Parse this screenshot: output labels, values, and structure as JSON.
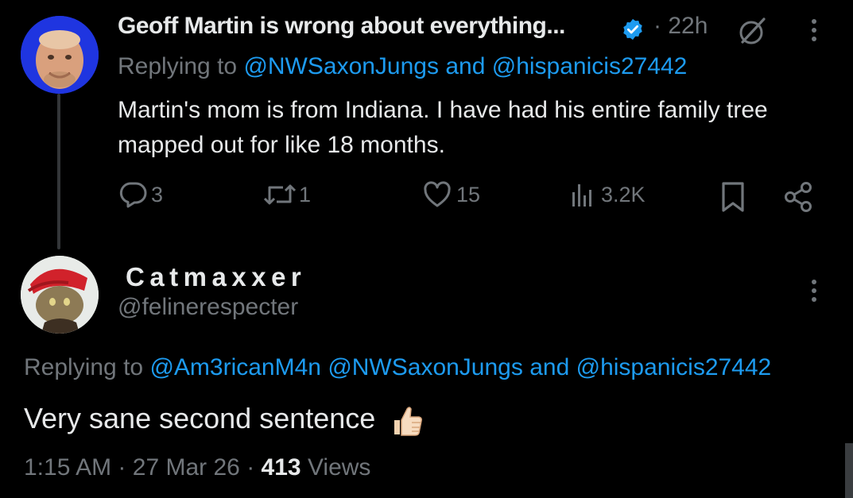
{
  "parent_tweet": {
    "author_name": "Geoff Martin is wrong about everything...",
    "dot": "·",
    "time": "22h",
    "replying_label": "Replying to",
    "mention_1": "@NWSaxonJungs",
    "and": "and",
    "mention_2": "@hispanicis27442",
    "text": "Martin's mom is from Indiana. I have had his entire family tree mapped out for like 18 months.",
    "replies": "3",
    "retweets": "1",
    "likes": "15",
    "views": "3.2K"
  },
  "reply_tweet": {
    "author_name": "Catmaxxer",
    "handle": "@felinerespecter",
    "replying_label": "Replying to",
    "mention_1": "@Am3ricanM4n",
    "mention_2": "@NWSaxonJungs",
    "and": "and",
    "mention_3": "@hispanicis27442",
    "text": "Very sane second sentence",
    "time": "1:15 AM",
    "date": "27 Mar 26",
    "views_count": "413",
    "views_label": "Views"
  },
  "colors": {
    "background": "#000000",
    "text": "#e7e9ea",
    "secondary": "#71767b",
    "accent": "#1d9bf0"
  },
  "icons": [
    "verified-icon",
    "grok-icon",
    "more-icon",
    "reply-icon",
    "retweet-icon",
    "like-icon",
    "views-icon",
    "bookmark-icon",
    "share-icon",
    "thumbs-up-emoji"
  ]
}
